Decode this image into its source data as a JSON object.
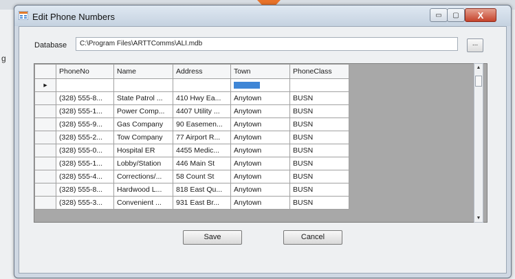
{
  "background": {
    "left_label": "g"
  },
  "window": {
    "title": "Edit Phone Numbers",
    "minimize_glyph": "▭",
    "maximize_glyph": "▢",
    "close_glyph": "X"
  },
  "database": {
    "label": "Database",
    "path": "C:\\Program Files\\ARTTComms\\ALI.mdb",
    "browse_label": "..."
  },
  "grid": {
    "row_indicator": "▸",
    "columns": [
      "PhoneNo",
      "Name",
      "Address",
      "Town",
      "PhoneClass"
    ],
    "rows": [
      [
        "(328) 555-8...",
        "State Patrol ...",
        "410 Hwy Ea...",
        "Anytown",
        "BUSN"
      ],
      [
        "(328) 555-1...",
        "Power Comp...",
        "4407 Utility ...",
        "Anytown",
        "BUSN"
      ],
      [
        "(328) 555-9...",
        "Gas Company",
        "90 Easemen...",
        "Anytown",
        "BUSN"
      ],
      [
        "(328) 555-2...",
        "Tow Company",
        "77 Airport R...",
        "Anytown",
        "BUSN"
      ],
      [
        "(328) 555-0...",
        "Hospital ER",
        "4455 Medic...",
        "Anytown",
        "BUSN"
      ],
      [
        "(328) 555-1...",
        "Lobby/Station",
        "446 Main St",
        "Anytown",
        "BUSN"
      ],
      [
        "(328) 555-4...",
        "Corrections/...",
        "58 Count St",
        "Anytown",
        "BUSN"
      ],
      [
        "(328) 555-8...",
        "Hardwood L...",
        "818 East Qu...",
        "Anytown",
        "BUSN"
      ],
      [
        "(328) 555-3...",
        "Convenient ...",
        "931 East Br...",
        "Anytown",
        "BUSN"
      ]
    ]
  },
  "buttons": {
    "save": "Save",
    "cancel": "Cancel"
  },
  "colors": {
    "selection": "#3f86d6",
    "accent": "#e8732a",
    "close": "#c5432b"
  }
}
